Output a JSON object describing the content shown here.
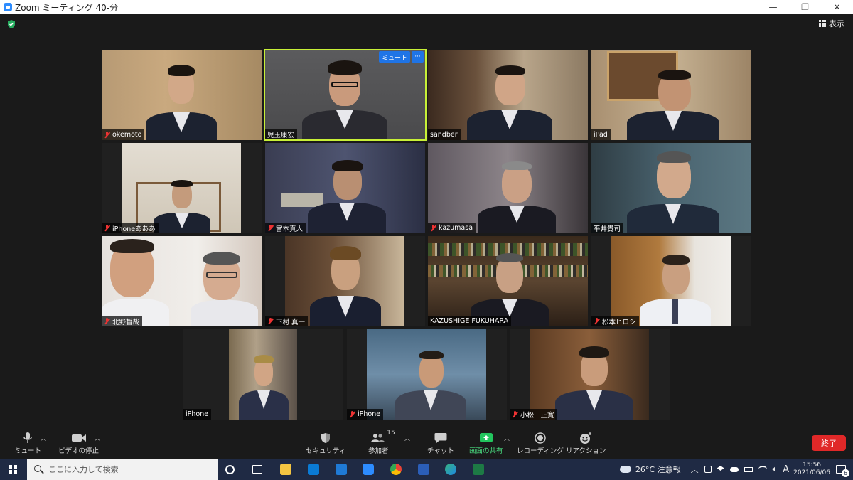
{
  "window": {
    "title": "Zoom ミーティング 40-分",
    "minimize": "—",
    "maximize": "❐",
    "close": "✕"
  },
  "meeting": {
    "view_label": "表示",
    "security_icon": "shield-check-icon",
    "active_speaker_buttons": {
      "mute": "ミュート",
      "more": "···"
    }
  },
  "participants": [
    {
      "name": "okemoto",
      "muted": true
    },
    {
      "name": "児玉康宏",
      "muted": false,
      "active": true
    },
    {
      "name": "sandber",
      "muted": false
    },
    {
      "name": "iPad",
      "muted": false
    },
    {
      "name": "iPhoneあああ",
      "muted": true
    },
    {
      "name": "宮本真人",
      "muted": true
    },
    {
      "name": "kazumasa",
      "muted": true
    },
    {
      "name": "平井貴司",
      "muted": false
    },
    {
      "name": "北野皙哉",
      "muted": true
    },
    {
      "name": "下村 真一",
      "muted": true
    },
    {
      "name": "KAZUSHIGE FUKUHARA",
      "muted": false
    },
    {
      "name": "松本ヒロシ",
      "muted": true
    },
    {
      "name": "iPhone",
      "muted": false
    },
    {
      "name": "iPhone",
      "muted": true
    },
    {
      "name": "小松　正寛",
      "muted": true
    }
  ],
  "toolbar": {
    "mute": "ミュート",
    "stop_video": "ビデオの停止",
    "security": "セキュリティ",
    "participants": "参加者",
    "participants_count": "15",
    "chat": "チャット",
    "share_screen": "画面の共有",
    "recording": "レコーディング",
    "reactions": "リアクション",
    "end": "終了"
  },
  "taskbar": {
    "search_placeholder": "ここに入力して検索",
    "weather": "26°C 注意報",
    "ime": "A",
    "time": "15:56",
    "date": "2021/06/06",
    "notification_count": "6"
  },
  "colors": {
    "zoom_blue": "#2D8CFF",
    "active_border": "#c8f037",
    "end_red": "#e02828",
    "share_green": "#22c55e",
    "muted_red": "#e33333"
  }
}
